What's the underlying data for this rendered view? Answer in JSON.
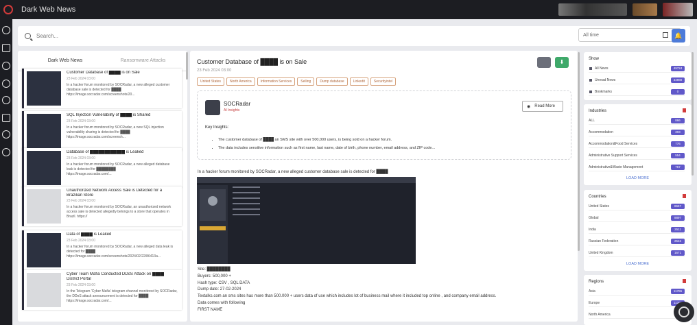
{
  "app": {
    "title": "Dark Web News"
  },
  "search": {
    "placeholder": "Search...",
    "time_value": "All time"
  },
  "left": {
    "tabs": [
      "Dark Web News",
      "Ransomware Attacks"
    ],
    "items": [
      {
        "title": "Customer Database of ████ is on Sale",
        "date": "23 Feb 2024 03:00",
        "desc": [
          "In a hacker forum monitored by SOCRadar, a new alleged customer",
          "database sale is detected for ████",
          "https://image.socradar.com/screenshots/20..."
        ],
        "light": false
      },
      {
        "title": "SQL Injection Vulnerability of ████ is Shared",
        "date": "23 Feb 2024 03:00",
        "desc": [
          "In a hacker forum monitored by SOCRadar, a new SQL injection",
          "vulnerability sharing is detected for ████",
          "https://image.socradar.com/screensh..."
        ],
        "light": false
      },
      {
        "title": "Database of ████████████ is Leaked",
        "date": "23 Feb 2024 03:00",
        "desc": [
          "In a hacker forum monitored by SOCRadar, a new alleged database",
          "leak is detected for ████████",
          "https://image.socradar.com/..."
        ],
        "light": false
      },
      {
        "title": "Unauthorized Network Access Sale is Detected for a",
        "date": "23 Feb 2024 03:00",
        "desc": [
          "In a hacker forum monitored by SOCRadar, an unauthorized network",
          "access sale is detected allegedly belongs to a store that operates in",
          "Brazil. https://"
        ],
        "light": true,
        "title2": "Brazilian Store"
      },
      {
        "title": "Data of ████ is Leaked",
        "date": "23 Feb 2024 03:00",
        "desc": [
          "In a hacker forum monitored by SOCRadar, a new alleged data leak is",
          "detected for ████",
          "https://image.socradar.com/screenshots/2024/02/22/86413a..."
        ],
        "light": false
      },
      {
        "title": "Cyber Team Mafia Conducted DDoS Attack on ████",
        "date": "23 Feb 2024 03:00",
        "desc": [
          "In the Telegram 'Cyber Mafia' telegram channel monitored by SOCRadar,",
          "the DDoS attack announcement is detected for ████",
          "https://image.socradar.com/..."
        ],
        "light": true,
        "title2": "District Portal"
      }
    ]
  },
  "article": {
    "title": "Customer Database of ████ is on Sale",
    "date": "23 Feb 2024 03:00",
    "tags": [
      "United States",
      "North America",
      "Information Services",
      "Selling",
      "Dump database",
      "Linkedit",
      "Securityintel"
    ],
    "source_name": "SOCRadar",
    "source_sub": "AI Insights",
    "read_more": "Read More",
    "key_title": "Key Insights:",
    "key_points": [
      "The customer database of ████ an SMS site with over 500,000 users, is being sold on a hacker forum.",
      "The data includes sensitive information such as first name, last name, date of birth, phone number, email address, and ZIP code..."
    ],
    "intro": "In a hacker forum monitored by SOCRadar, a new alleged customer database sale is detected for ████",
    "body": [
      "Site: ████████",
      "Buyers: 500,000 +",
      "Hash type: CSV , SQL DATA",
      "Dump date: 27-02-2024",
      "Textalks.com an sms sites has more than 500.000 + users data of use which includes lot of business mail where it included top online , and company email address.",
      "Data comes with following",
      "FIRST NAME"
    ]
  },
  "show": {
    "title": "Show",
    "rows": [
      {
        "label": "All News",
        "count": "49724"
      },
      {
        "label": "Unread News",
        "count": "44980"
      },
      {
        "label": "Bookmarks",
        "count": "0"
      }
    ]
  },
  "industries": {
    "title": "Industries",
    "rows": [
      {
        "label": "ALL",
        "count": "866"
      },
      {
        "label": "Accommodation",
        "count": "303"
      },
      {
        "label": "Accommodation&Food Services",
        "count": "776"
      },
      {
        "label": "Administrative Support Services",
        "count": "554"
      },
      {
        "label": "Administrative&Waste Management",
        "count": "757"
      }
    ],
    "load_more": "LOAD MORE"
  },
  "countries": {
    "title": "Countries",
    "rows": [
      {
        "label": "United States",
        "count": "8657"
      },
      {
        "label": "Global",
        "count": "8897"
      },
      {
        "label": "India",
        "count": "2511"
      },
      {
        "label": "Russian Federation",
        "count": "2546"
      },
      {
        "label": "United Kingdom",
        "count": "1671"
      }
    ],
    "load_more": "LOAD MORE"
  },
  "regions": {
    "title": "Regions",
    "rows": [
      {
        "label": "Asia",
        "count": "11786"
      },
      {
        "label": "Europe",
        "count": "11391"
      },
      {
        "label": "North America",
        "count": ""
      }
    ]
  }
}
